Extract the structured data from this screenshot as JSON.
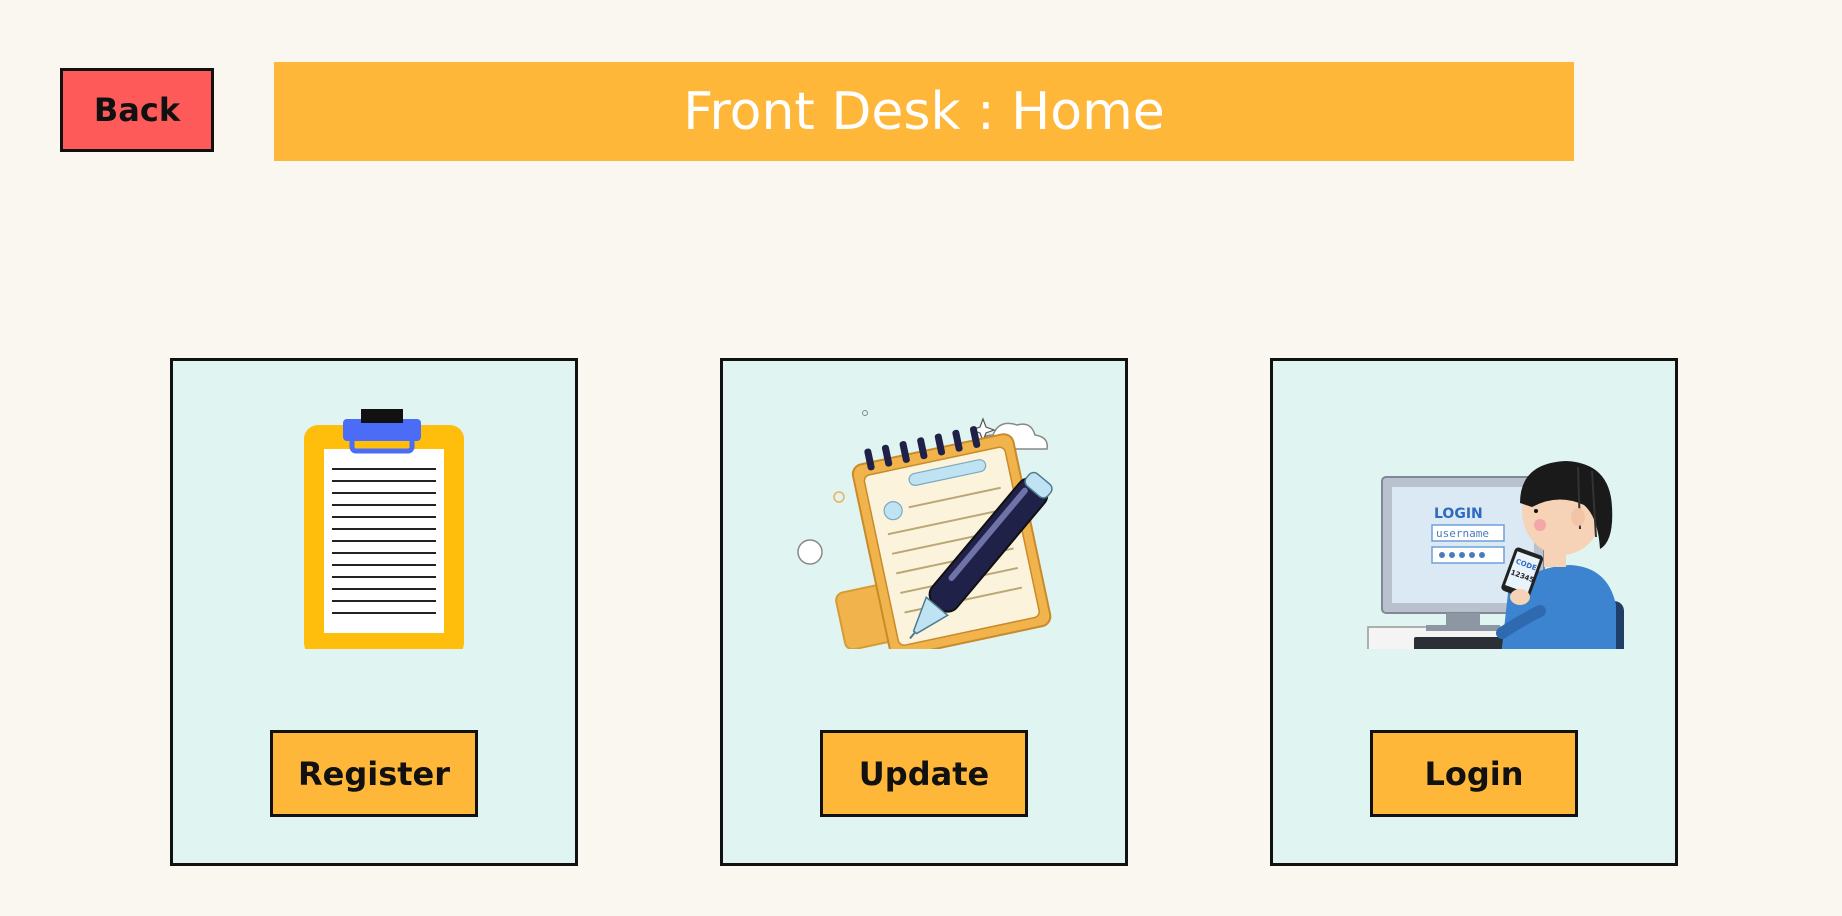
{
  "header": {
    "back_label": "Back",
    "title": "Front Desk : Home"
  },
  "cards": [
    {
      "icon": "clipboard-icon",
      "button_label": "Register"
    },
    {
      "icon": "notepad-pen-icon",
      "button_label": "Update"
    },
    {
      "icon": "person-login-computer-icon",
      "button_label": "Login",
      "illustration_text": [
        "LOGIN",
        "username",
        "CODE",
        "12345"
      ]
    }
  ],
  "colors": {
    "background": "#faf7f0",
    "title_bar": "#ffb739",
    "back_button": "#ff5a5a",
    "card_background": "#e0f4f1",
    "button": "#ffb739"
  }
}
